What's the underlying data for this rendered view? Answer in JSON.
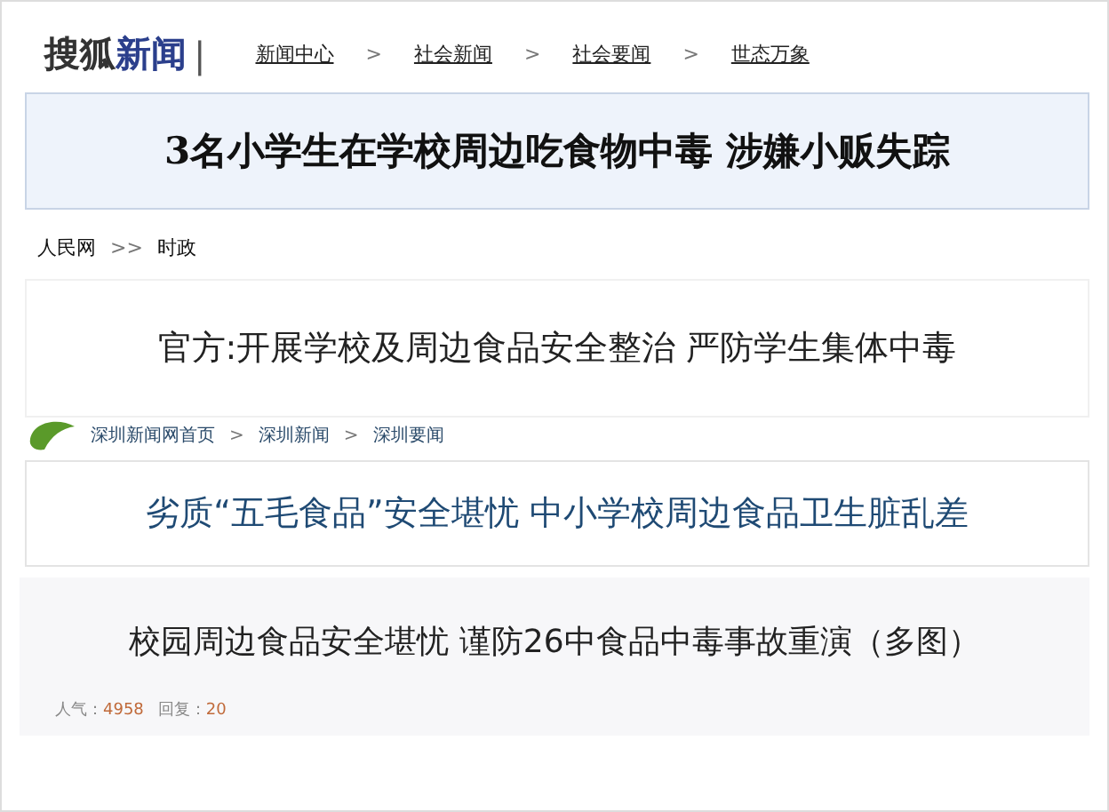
{
  "clippings": [
    {
      "kind": "sohu",
      "logo": {
        "dark": "搜狐",
        "accent": "新闻",
        "divider": "|"
      },
      "breadcrumbs": [
        {
          "label": "新闻中心"
        },
        {
          "label": "社会新闻"
        },
        {
          "label": "社会要闻"
        },
        {
          "label": "世态万象"
        }
      ],
      "separator": ">",
      "headline": "3名小学生在学校周边吃食物中毒  涉嫌小贩失踪"
    },
    {
      "kind": "people",
      "breadcrumbs": [
        {
          "label": "人民网"
        },
        {
          "label": "时政"
        }
      ],
      "separator": ">>",
      "headline": "官方:开展学校及周边食品安全整治 严防学生集体中毒"
    },
    {
      "kind": "shenzhen",
      "breadcrumbs": [
        {
          "label": "深圳新闻网首页"
        },
        {
          "label": "深圳新闻"
        },
        {
          "label": "深圳要闻"
        }
      ],
      "separator": ">",
      "headline": "劣质“五毛食品”安全堪忧 中小学校周边食品卫生脏乱差"
    },
    {
      "kind": "forum",
      "headline": "校园周边食品安全堪忧 谨防26中食品中毒事故重演（多图）",
      "meta": [
        {
          "label": "人气：",
          "value": "4958"
        },
        {
          "label": "回复：",
          "value": "20"
        }
      ]
    }
  ]
}
